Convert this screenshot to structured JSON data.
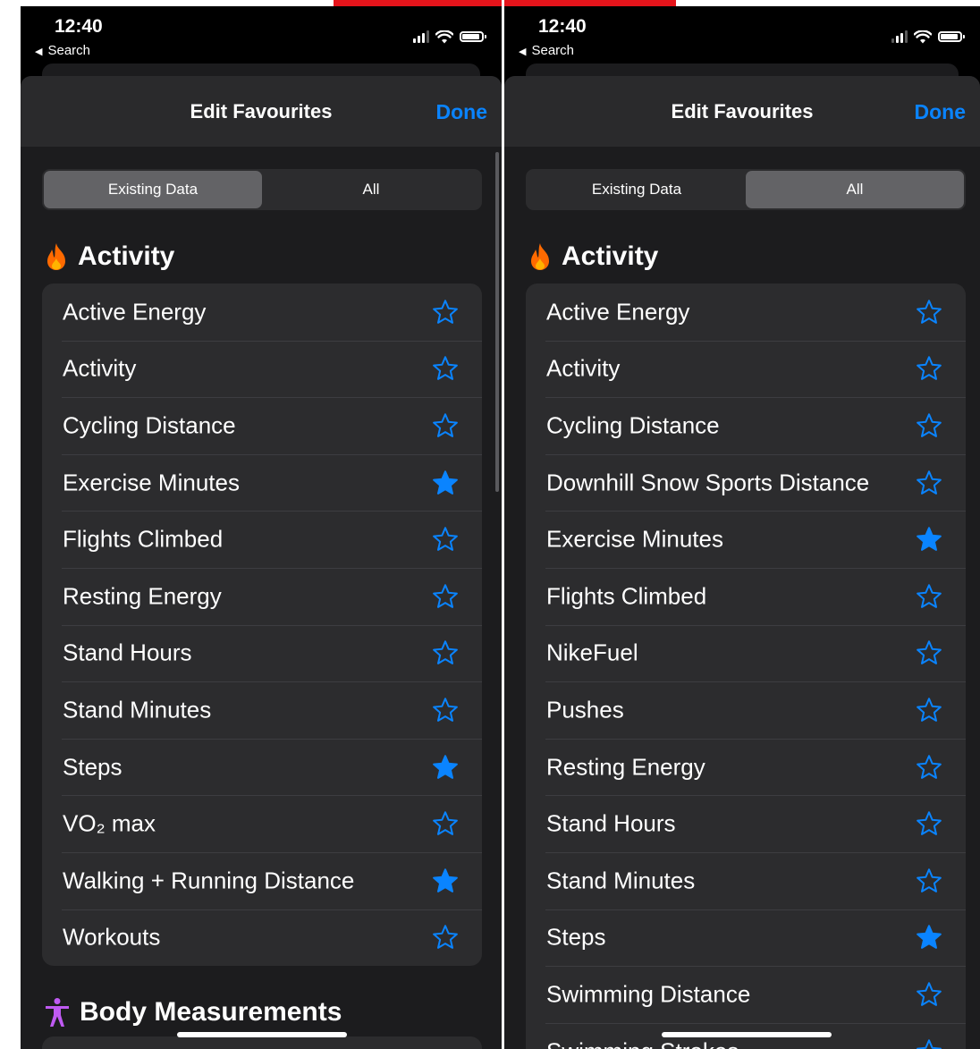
{
  "colors": {
    "accent": "#0a84ff",
    "activity_icon": "#ff6a00",
    "body_icon": "#bf5af2",
    "background": "#1c1c1e"
  },
  "left": {
    "status": {
      "time": "12:40",
      "back_label": "Search"
    },
    "nav": {
      "title": "Edit Favourites",
      "done": "Done"
    },
    "segments": [
      {
        "label": "Existing Data",
        "selected": true
      },
      {
        "label": "All",
        "selected": false
      }
    ],
    "section": {
      "title": "Activity",
      "icon": "flame-icon"
    },
    "items": [
      {
        "label": "Active Energy",
        "favourite": false
      },
      {
        "label": "Activity",
        "favourite": false
      },
      {
        "label": "Cycling Distance",
        "favourite": false
      },
      {
        "label": "Exercise Minutes",
        "favourite": true
      },
      {
        "label": "Flights Climbed",
        "favourite": false
      },
      {
        "label": "Resting Energy",
        "favourite": false
      },
      {
        "label": "Stand Hours",
        "favourite": false
      },
      {
        "label": "Stand Minutes",
        "favourite": false
      },
      {
        "label": "Steps",
        "favourite": true
      },
      {
        "label": "VO₂ max",
        "favourite": false
      },
      {
        "label": "Walking + Running Distance",
        "favourite": true
      },
      {
        "label": "Workouts",
        "favourite": false
      }
    ],
    "next_section": {
      "title": "Body Measurements",
      "icon": "body-figure-icon"
    }
  },
  "right": {
    "status": {
      "time": "12:40",
      "back_label": "Search"
    },
    "nav": {
      "title": "Edit Favourites",
      "done": "Done"
    },
    "segments": [
      {
        "label": "Existing Data",
        "selected": false
      },
      {
        "label": "All",
        "selected": true
      }
    ],
    "section": {
      "title": "Activity",
      "icon": "flame-icon"
    },
    "items": [
      {
        "label": "Active Energy",
        "favourite": false
      },
      {
        "label": "Activity",
        "favourite": false
      },
      {
        "label": "Cycling Distance",
        "favourite": false
      },
      {
        "label": "Downhill Snow Sports Distance",
        "favourite": false
      },
      {
        "label": "Exercise Minutes",
        "favourite": true
      },
      {
        "label": "Flights Climbed",
        "favourite": false
      },
      {
        "label": "NikeFuel",
        "favourite": false
      },
      {
        "label": "Pushes",
        "favourite": false
      },
      {
        "label": "Resting Energy",
        "favourite": false
      },
      {
        "label": "Stand Hours",
        "favourite": false
      },
      {
        "label": "Stand Minutes",
        "favourite": false
      },
      {
        "label": "Steps",
        "favourite": true
      },
      {
        "label": "Swimming Distance",
        "favourite": false
      },
      {
        "label": "Swimming Strokes",
        "favourite": false
      }
    ]
  }
}
